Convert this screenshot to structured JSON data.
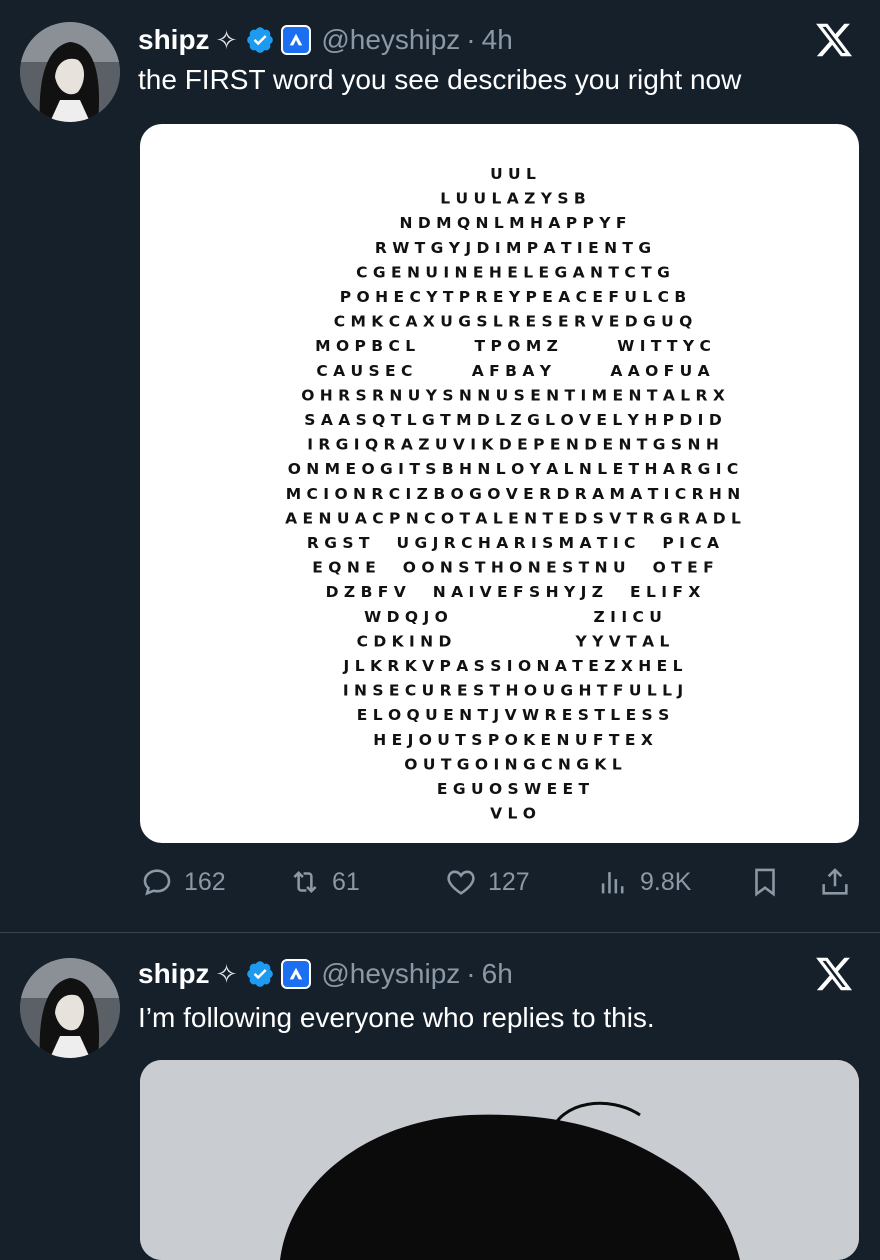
{
  "tweets": [
    {
      "name": "shipz",
      "sparkle": "✧",
      "handle": "@heyshipz",
      "time_sep": "·",
      "time": "4h",
      "text": "the FIRST word you see describes you right now",
      "actions": {
        "replies": "162",
        "retweets": "61",
        "likes": "127",
        "views": "9.8K"
      }
    },
    {
      "name": "shipz",
      "sparkle": "✧",
      "handle": "@heyshipz",
      "time_sep": "·",
      "time": "6h",
      "text": "I’m following everyone who replies to this."
    }
  ],
  "wordsearch_rows": [
    "U U L",
    "L U U L A Z Y S B",
    "N D M Q N L M H A P P Y F",
    "R W T G Y J D I M P A T I E N T G",
    "C G E N U I N E H E L E G A N T C T G",
    "P O H E C Y T P R E Y P E A C E F U L C B",
    "C M K C A X U G S L R E S E R V E D G U Q",
    "M O P B C L           T P O M Z           W I T T Y C",
    "C A U S E C           A F B A Y           A A O F U A",
    "O H R S R N U Y S N N U S E N T I M E N T A L R X",
    "S A A S Q T L G T M D L Z G L O V E L Y H P D I D",
    "I R G I Q R A Z U V I K D E P E N D E N T G S N H",
    "O N M E O G I T S B H N L O Y A L N L E T H A R G I C",
    "M C I O N R C I Z B O G O V E R D R A M A T I C R H N",
    "A E N U A C P N C O T A L E N T E D S V T R G R A D L",
    "R G S T     U G J R C H A R I S M A T I C     P I C A",
    "E Q N E     O O N S T H O N E S T N U     O T E F",
    "D Z B F V     N A I V E F S H Y J Z     E L I F X",
    "W D Q J O                           Z I I C U",
    "C D K I N D                       Y Y V T A L",
    "J L K R K V P A S S I O N A T E Z X H E L",
    "I N S E C U R E S T H O U G H T F U L L J",
    "E L O Q U E N T J V W R E S T L E S S",
    "H E J O U T S P O K E N U F T E X",
    "O U T G O I N G C N G K L",
    "E G U O S W E E T",
    "V L O"
  ],
  "colors": {
    "background": "#15202b",
    "secondary_text": "#8b98a5",
    "verified": "#1d9bf0",
    "affiliate": "#1d6ff2"
  },
  "icons": [
    "sparkle-icon",
    "verified-badge-icon",
    "affiliate-badge-icon",
    "x-logo-icon",
    "reply-icon",
    "retweet-icon",
    "like-icon",
    "views-icon",
    "bookmark-icon",
    "share-icon"
  ]
}
